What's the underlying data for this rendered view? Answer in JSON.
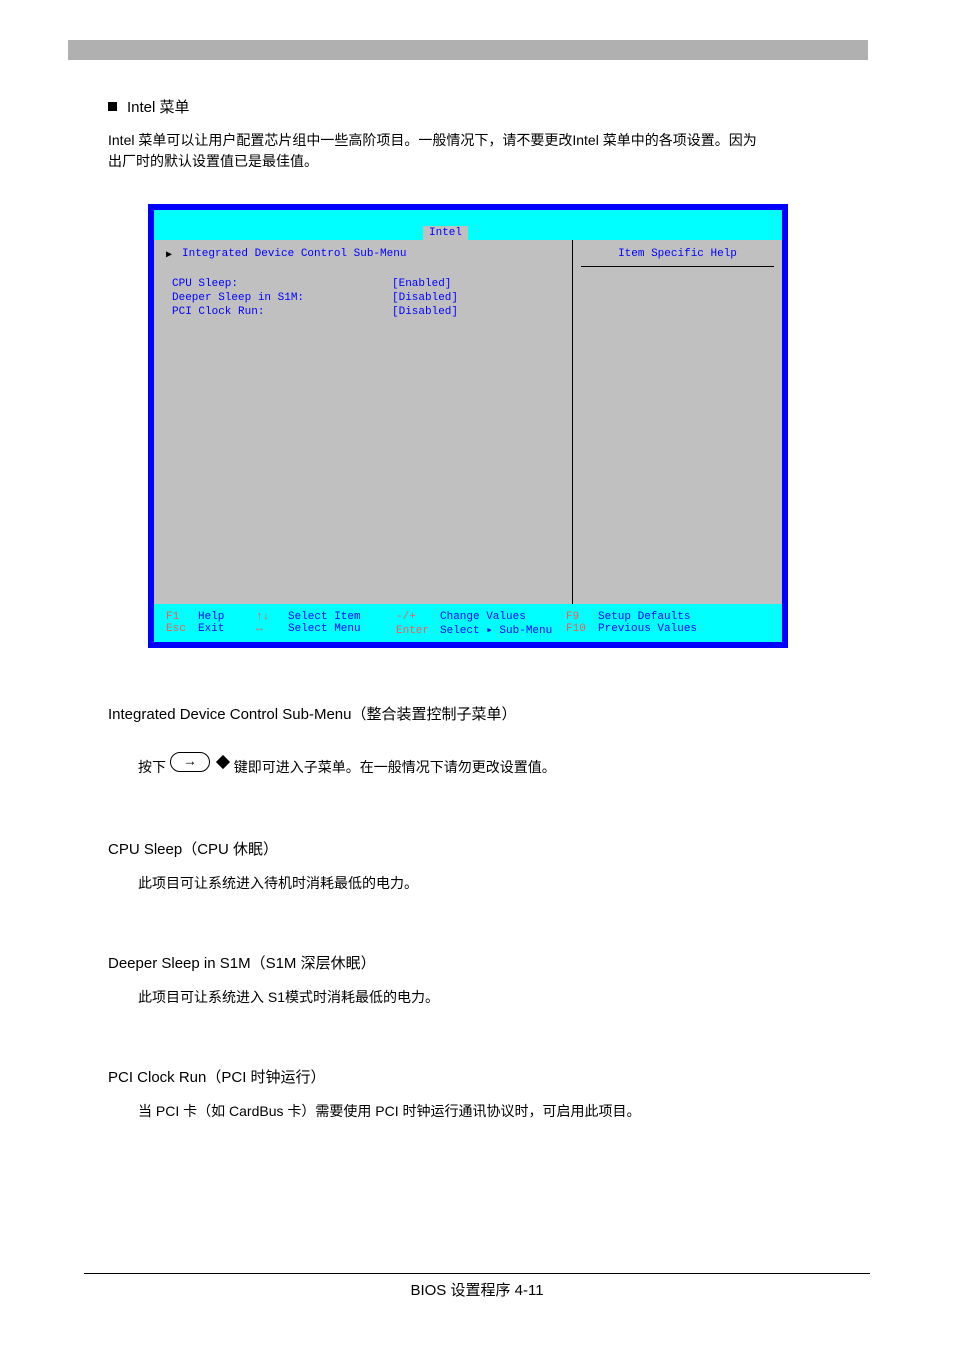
{
  "page": {
    "title": "Intel 菜单",
    "description": "Intel 菜单可以让用户配置芯片组中一些高阶项目。一般情况下，请不要更改Intel 菜单中的各项设置。因为出厂时的默认设置值已是最佳值。",
    "footer": "BIOS 设置程序  4-11"
  },
  "bios": {
    "tab": "Intel",
    "help_title": "Item Specific Help",
    "submenu": "Integrated Device Control Sub-Menu",
    "items": [
      {
        "label": "CPU Sleep:",
        "value": "[Enabled]"
      },
      {
        "label": "Deeper Sleep in S1M:",
        "value": "[Disabled]"
      },
      {
        "label": "PCI Clock Run:",
        "value": "[Disabled]"
      }
    ],
    "footer_rows": [
      [
        {
          "key": "F1",
          "label": "Help"
        },
        {
          "key": "↑↓",
          "label": "Select Item"
        },
        {
          "key": "-/+",
          "label": "Change Values"
        },
        {
          "key": "F9",
          "label": "Setup Defaults"
        }
      ],
      [
        {
          "key": "Esc",
          "label": "Exit"
        },
        {
          "key": "↔",
          "label": "Select Menu"
        },
        {
          "key": "Enter",
          "label": "Select ▸ Sub-Menu"
        },
        {
          "key": "F10",
          "label": "Previous Values"
        }
      ]
    ]
  },
  "sections": {
    "s1": {
      "heading": "Integrated Device Control Sub-Menu（整合装置控制子菜单）",
      "body_pre": "按下 ",
      "body_post": " 键即可进入子菜单。在一般情况下请勿更改设置值。"
    },
    "s2": {
      "heading": "CPU Sleep（CPU 休眠）",
      "body": "此项目可让系统进入待机时消耗最低的电力。"
    },
    "s3": {
      "heading": "Deeper Sleep in S1M（S1M 深层休眠）",
      "body": "此项目可让系统进入 S1模式时消耗最低的电力。"
    },
    "s4": {
      "heading": "PCI Clock Run（PCI 时钟运行）",
      "body": "当 PCI 卡（如 CardBus 卡）需要使用 PCI 时钟运行通讯协议时，可启用此项目。"
    }
  }
}
